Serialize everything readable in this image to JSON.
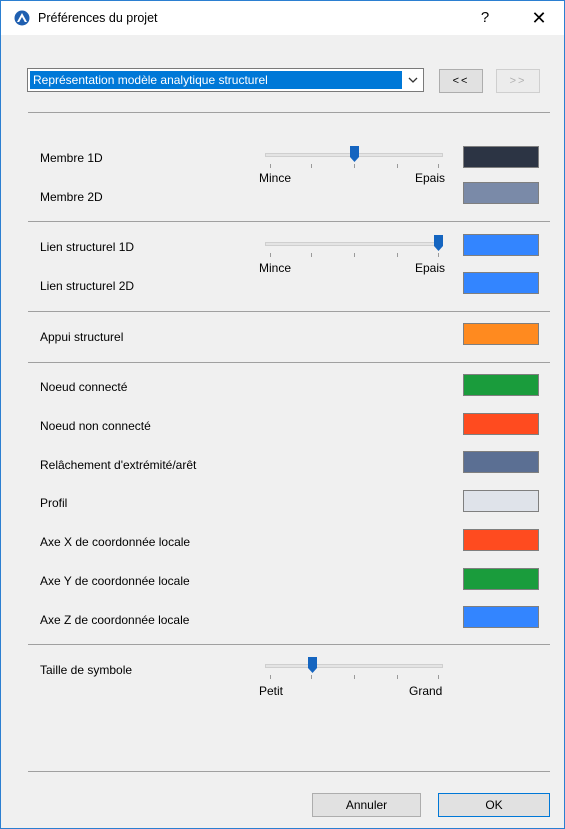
{
  "window": {
    "title": "Préférences du projet",
    "help": "?",
    "close": "✕"
  },
  "dropdown": {
    "value": "Représentation modèle analytique structurel"
  },
  "nav": {
    "prev": "<<",
    "next": ">>"
  },
  "sections": {
    "members": {
      "label_1d": "Membre 1D",
      "label_2d": "Membre 2D",
      "slider": {
        "min_label": "Mince",
        "max_label": "Epais",
        "value_fraction": 0.5
      },
      "color_1d": "#2c3444",
      "color_2d": "#7a8aa8"
    },
    "links": {
      "label_1d": "Lien structurel 1D",
      "label_2d": "Lien structurel 2D",
      "slider": {
        "min_label": "Mince",
        "max_label": "Epais",
        "value_fraction": 1.0
      },
      "color_1d": "#3385ff",
      "color_2d": "#3385ff"
    },
    "support": {
      "label": "Appui structurel",
      "color": "#ff8a1f"
    },
    "nodes": [
      {
        "label": "Noeud connecté",
        "color": "#1a9c3c"
      },
      {
        "label": "Noeud non connecté",
        "color": "#ff4b1f"
      },
      {
        "label": "Relâchement d'extrémité/arêt",
        "color": "#5b6f93"
      },
      {
        "label": "Profil",
        "color": "#dfe3ea"
      },
      {
        "label": "Axe X de coordonnée locale",
        "color": "#ff4b1f"
      },
      {
        "label": "Axe Y de coordonnée locale",
        "color": "#1a9c3c"
      },
      {
        "label": "Axe Z de coordonnée locale",
        "color": "#3385ff"
      }
    ],
    "symbol": {
      "label": "Taille de symbole",
      "slider": {
        "min_label": "Petit",
        "max_label": "Grand",
        "value_fraction": 0.25
      }
    }
  },
  "buttons": {
    "cancel": "Annuler",
    "ok": "OK"
  },
  "colors": {
    "accent": "#0078d7",
    "thumb": "#1565c0"
  }
}
